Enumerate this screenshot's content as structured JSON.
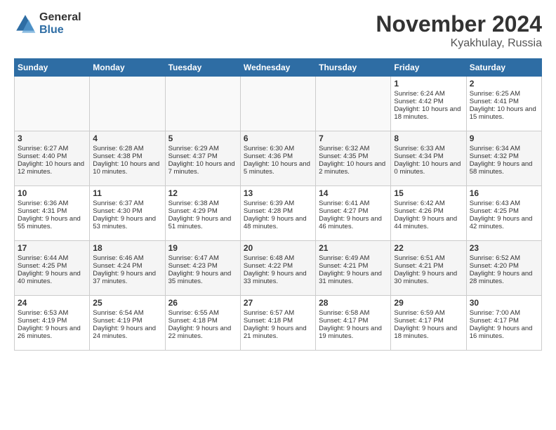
{
  "logo": {
    "general": "General",
    "blue": "Blue"
  },
  "title": "November 2024",
  "location": "Kyakhulay, Russia",
  "days_header": [
    "Sunday",
    "Monday",
    "Tuesday",
    "Wednesday",
    "Thursday",
    "Friday",
    "Saturday"
  ],
  "weeks": [
    [
      {
        "day": "",
        "content": ""
      },
      {
        "day": "",
        "content": ""
      },
      {
        "day": "",
        "content": ""
      },
      {
        "day": "",
        "content": ""
      },
      {
        "day": "",
        "content": ""
      },
      {
        "day": "1",
        "content": "Sunrise: 6:24 AM\nSunset: 4:42 PM\nDaylight: 10 hours and 18 minutes."
      },
      {
        "day": "2",
        "content": "Sunrise: 6:25 AM\nSunset: 4:41 PM\nDaylight: 10 hours and 15 minutes."
      }
    ],
    [
      {
        "day": "3",
        "content": "Sunrise: 6:27 AM\nSunset: 4:40 PM\nDaylight: 10 hours and 12 minutes."
      },
      {
        "day": "4",
        "content": "Sunrise: 6:28 AM\nSunset: 4:38 PM\nDaylight: 10 hours and 10 minutes."
      },
      {
        "day": "5",
        "content": "Sunrise: 6:29 AM\nSunset: 4:37 PM\nDaylight: 10 hours and 7 minutes."
      },
      {
        "day": "6",
        "content": "Sunrise: 6:30 AM\nSunset: 4:36 PM\nDaylight: 10 hours and 5 minutes."
      },
      {
        "day": "7",
        "content": "Sunrise: 6:32 AM\nSunset: 4:35 PM\nDaylight: 10 hours and 2 minutes."
      },
      {
        "day": "8",
        "content": "Sunrise: 6:33 AM\nSunset: 4:34 PM\nDaylight: 10 hours and 0 minutes."
      },
      {
        "day": "9",
        "content": "Sunrise: 6:34 AM\nSunset: 4:32 PM\nDaylight: 9 hours and 58 minutes."
      }
    ],
    [
      {
        "day": "10",
        "content": "Sunrise: 6:36 AM\nSunset: 4:31 PM\nDaylight: 9 hours and 55 minutes."
      },
      {
        "day": "11",
        "content": "Sunrise: 6:37 AM\nSunset: 4:30 PM\nDaylight: 9 hours and 53 minutes."
      },
      {
        "day": "12",
        "content": "Sunrise: 6:38 AM\nSunset: 4:29 PM\nDaylight: 9 hours and 51 minutes."
      },
      {
        "day": "13",
        "content": "Sunrise: 6:39 AM\nSunset: 4:28 PM\nDaylight: 9 hours and 48 minutes."
      },
      {
        "day": "14",
        "content": "Sunrise: 6:41 AM\nSunset: 4:27 PM\nDaylight: 9 hours and 46 minutes."
      },
      {
        "day": "15",
        "content": "Sunrise: 6:42 AM\nSunset: 4:26 PM\nDaylight: 9 hours and 44 minutes."
      },
      {
        "day": "16",
        "content": "Sunrise: 6:43 AM\nSunset: 4:25 PM\nDaylight: 9 hours and 42 minutes."
      }
    ],
    [
      {
        "day": "17",
        "content": "Sunrise: 6:44 AM\nSunset: 4:25 PM\nDaylight: 9 hours and 40 minutes."
      },
      {
        "day": "18",
        "content": "Sunrise: 6:46 AM\nSunset: 4:24 PM\nDaylight: 9 hours and 37 minutes."
      },
      {
        "day": "19",
        "content": "Sunrise: 6:47 AM\nSunset: 4:23 PM\nDaylight: 9 hours and 35 minutes."
      },
      {
        "day": "20",
        "content": "Sunrise: 6:48 AM\nSunset: 4:22 PM\nDaylight: 9 hours and 33 minutes."
      },
      {
        "day": "21",
        "content": "Sunrise: 6:49 AM\nSunset: 4:21 PM\nDaylight: 9 hours and 31 minutes."
      },
      {
        "day": "22",
        "content": "Sunrise: 6:51 AM\nSunset: 4:21 PM\nDaylight: 9 hours and 30 minutes."
      },
      {
        "day": "23",
        "content": "Sunrise: 6:52 AM\nSunset: 4:20 PM\nDaylight: 9 hours and 28 minutes."
      }
    ],
    [
      {
        "day": "24",
        "content": "Sunrise: 6:53 AM\nSunset: 4:19 PM\nDaylight: 9 hours and 26 minutes."
      },
      {
        "day": "25",
        "content": "Sunrise: 6:54 AM\nSunset: 4:19 PM\nDaylight: 9 hours and 24 minutes."
      },
      {
        "day": "26",
        "content": "Sunrise: 6:55 AM\nSunset: 4:18 PM\nDaylight: 9 hours and 22 minutes."
      },
      {
        "day": "27",
        "content": "Sunrise: 6:57 AM\nSunset: 4:18 PM\nDaylight: 9 hours and 21 minutes."
      },
      {
        "day": "28",
        "content": "Sunrise: 6:58 AM\nSunset: 4:17 PM\nDaylight: 9 hours and 19 minutes."
      },
      {
        "day": "29",
        "content": "Sunrise: 6:59 AM\nSunset: 4:17 PM\nDaylight: 9 hours and 18 minutes."
      },
      {
        "day": "30",
        "content": "Sunrise: 7:00 AM\nSunset: 4:17 PM\nDaylight: 9 hours and 16 minutes."
      }
    ]
  ]
}
